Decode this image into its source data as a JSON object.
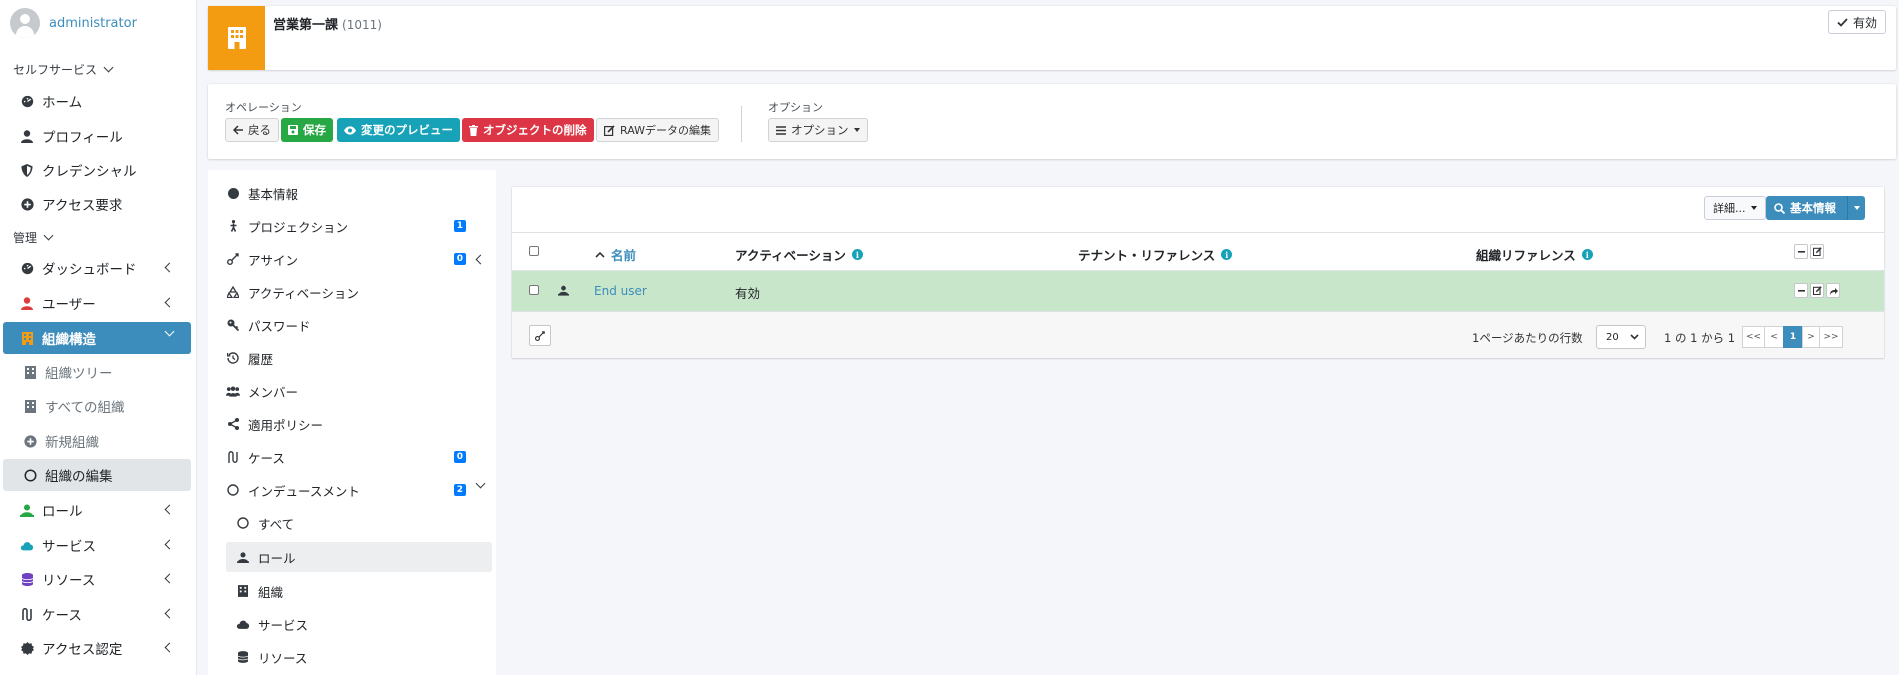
{
  "user": {
    "name": "administrator"
  },
  "sidebar": {
    "section_self": "セルフサービス",
    "self_items": [
      {
        "label": "ホーム",
        "icon": "dashboard-icon"
      },
      {
        "label": "プロフィール",
        "icon": "user-icon"
      },
      {
        "label": "クレデンシャル",
        "icon": "shield-icon"
      },
      {
        "label": "アクセス要求",
        "icon": "plus-circle-icon"
      }
    ],
    "section_admin": "管理",
    "admin_items": [
      {
        "label": "ダッシュボード",
        "icon": "dashboard-icon"
      },
      {
        "label": "ユーザー",
        "icon": "user-icon"
      },
      {
        "label": "組織構造",
        "icon": "building-icon"
      },
      {
        "label": "組織ツリー",
        "icon": "building-icon"
      },
      {
        "label": "すべての組織",
        "icon": "building-icon"
      },
      {
        "label": "新規組織",
        "icon": "plus-circle-icon"
      },
      {
        "label": "組織の編集",
        "icon": "circle-icon"
      },
      {
        "label": "ロール",
        "icon": "role-icon"
      },
      {
        "label": "サービス",
        "icon": "cloud-icon"
      },
      {
        "label": "リソース",
        "icon": "database-icon"
      },
      {
        "label": "ケース",
        "icon": "case-icon"
      },
      {
        "label": "アクセス認定",
        "icon": "certificate-icon"
      }
    ]
  },
  "header": {
    "title": "営業第一課",
    "id": "(1011)",
    "status": "有効",
    "accent": "#f39c12"
  },
  "operations": {
    "label": "オペレーション",
    "back": "戻る",
    "save": "保存",
    "preview": "変更のプレビュー",
    "delete": "オブジェクトの削除",
    "raw_edit": "RAWデータの編集",
    "options_label": "オプション",
    "options_button": "オプション"
  },
  "subnav": {
    "items": [
      {
        "label": "基本情報",
        "badge": ""
      },
      {
        "label": "プロジェクション",
        "badge": "1"
      },
      {
        "label": "アサイン",
        "badge": "0"
      },
      {
        "label": "アクティベーション",
        "badge": ""
      },
      {
        "label": "パスワード",
        "badge": ""
      },
      {
        "label": "履歴",
        "badge": ""
      },
      {
        "label": "メンバー",
        "badge": ""
      },
      {
        "label": "適用ポリシー",
        "badge": ""
      },
      {
        "label": "ケース",
        "badge": "0"
      },
      {
        "label": "インデュースメント",
        "badge": "2"
      }
    ],
    "children": [
      {
        "label": "すべて"
      },
      {
        "label": "ロール"
      },
      {
        "label": "組織"
      },
      {
        "label": "サービス"
      },
      {
        "label": "リソース"
      }
    ]
  },
  "table": {
    "detail_button": "詳細...",
    "basic_button": "基本情報",
    "columns": {
      "name": "名前",
      "activation": "アクティベーション",
      "tenant_ref": "テナント・リファレンス",
      "org_ref": "組織リファレンス"
    },
    "rows": [
      {
        "name": "End user",
        "activation": "有効",
        "tenant_ref": "",
        "org_ref": ""
      }
    ],
    "footer": {
      "rows_per_page_label": "1ページあたりの行数",
      "rows_per_page": "20",
      "range": "1 の 1 から 1",
      "pages": {
        "first": "<<",
        "prev": "<",
        "current": "1",
        "next": ">",
        "last": ">>"
      }
    },
    "row_color": "#c8e6c9"
  }
}
